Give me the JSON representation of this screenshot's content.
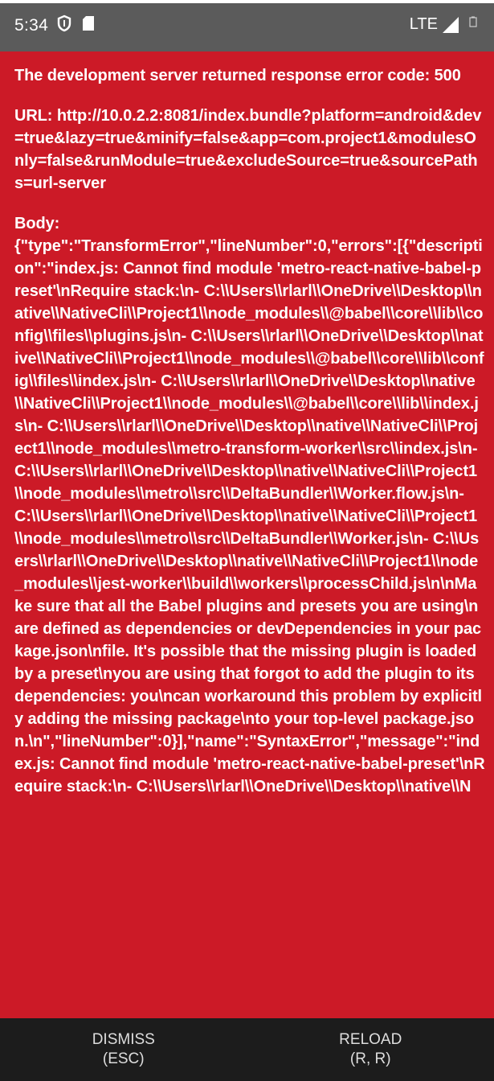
{
  "status_bar": {
    "time": "5:34",
    "network": "LTE",
    "left_icons": [
      "shield-icon",
      "sd-card-icon"
    ],
    "right_icons": [
      "signal-icon",
      "battery-icon"
    ]
  },
  "error": {
    "heading": "The development server returned response error code: 500",
    "url": "URL: http://10.0.2.2:8081/index.bundle?platform=android&dev=true&lazy=true&minify=false&app=com.project1&modulesOnly=false&runModule=true&excludeSource=true&sourcePaths=url-server",
    "body_label": "Body:",
    "body": "{\"type\":\"TransformError\",\"lineNumber\":0,\"errors\":[{\"description\":\"index.js: Cannot find module 'metro-react-native-babel-preset'\\nRequire stack:\\n- C:\\\\Users\\\\rlarl\\\\OneDrive\\\\Desktop\\\\native\\\\NativeCli\\\\Project1\\\\node_modules\\\\@babel\\\\core\\\\lib\\\\config\\\\files\\\\plugins.js\\n- C:\\\\Users\\\\rlarl\\\\OneDrive\\\\Desktop\\\\native\\\\NativeCli\\\\Project1\\\\node_modules\\\\@babel\\\\core\\\\lib\\\\config\\\\files\\\\index.js\\n- C:\\\\Users\\\\rlarl\\\\OneDrive\\\\Desktop\\\\native\\\\NativeCli\\\\Project1\\\\node_modules\\\\@babel\\\\core\\\\lib\\\\index.js\\n- C:\\\\Users\\\\rlarl\\\\OneDrive\\\\Desktop\\\\native\\\\NativeCli\\\\Project1\\\\node_modules\\\\metro-transform-worker\\\\src\\\\index.js\\n- C:\\\\Users\\\\rlarl\\\\OneDrive\\\\Desktop\\\\native\\\\NativeCli\\\\Project1\\\\node_modules\\\\metro\\\\src\\\\DeltaBundler\\\\Worker.flow.js\\n- C:\\\\Users\\\\rlarl\\\\OneDrive\\\\Desktop\\\\native\\\\NativeCli\\\\Project1\\\\node_modules\\\\metro\\\\src\\\\DeltaBundler\\\\Worker.js\\n- C:\\\\Users\\\\rlarl\\\\OneDrive\\\\Desktop\\\\native\\\\NativeCli\\\\Project1\\\\node_modules\\\\jest-worker\\\\build\\\\workers\\\\processChild.js\\n\\nMake sure that all the Babel plugins and presets you are using\\nare defined as dependencies or devDependencies in your package.json\\nfile. It's possible that the missing plugin is loaded by a preset\\nyou are using that forgot to add the plugin to its dependencies: you\\ncan workaround this problem by explicitly adding the missing package\\nto your top-level package.json.\\n\",\"lineNumber\":0}],\"name\":\"SyntaxError\",\"message\":\"index.js: Cannot find module 'metro-react-native-babel-preset'\\nRequire stack:\\n- C:\\\\Users\\\\rlarl\\\\OneDrive\\\\Desktop\\\\native\\\\N"
  },
  "actions": {
    "dismiss_label": "DISMISS",
    "dismiss_shortcut": "(ESC)",
    "reload_label": "RELOAD",
    "reload_shortcut": "(R, R)"
  }
}
